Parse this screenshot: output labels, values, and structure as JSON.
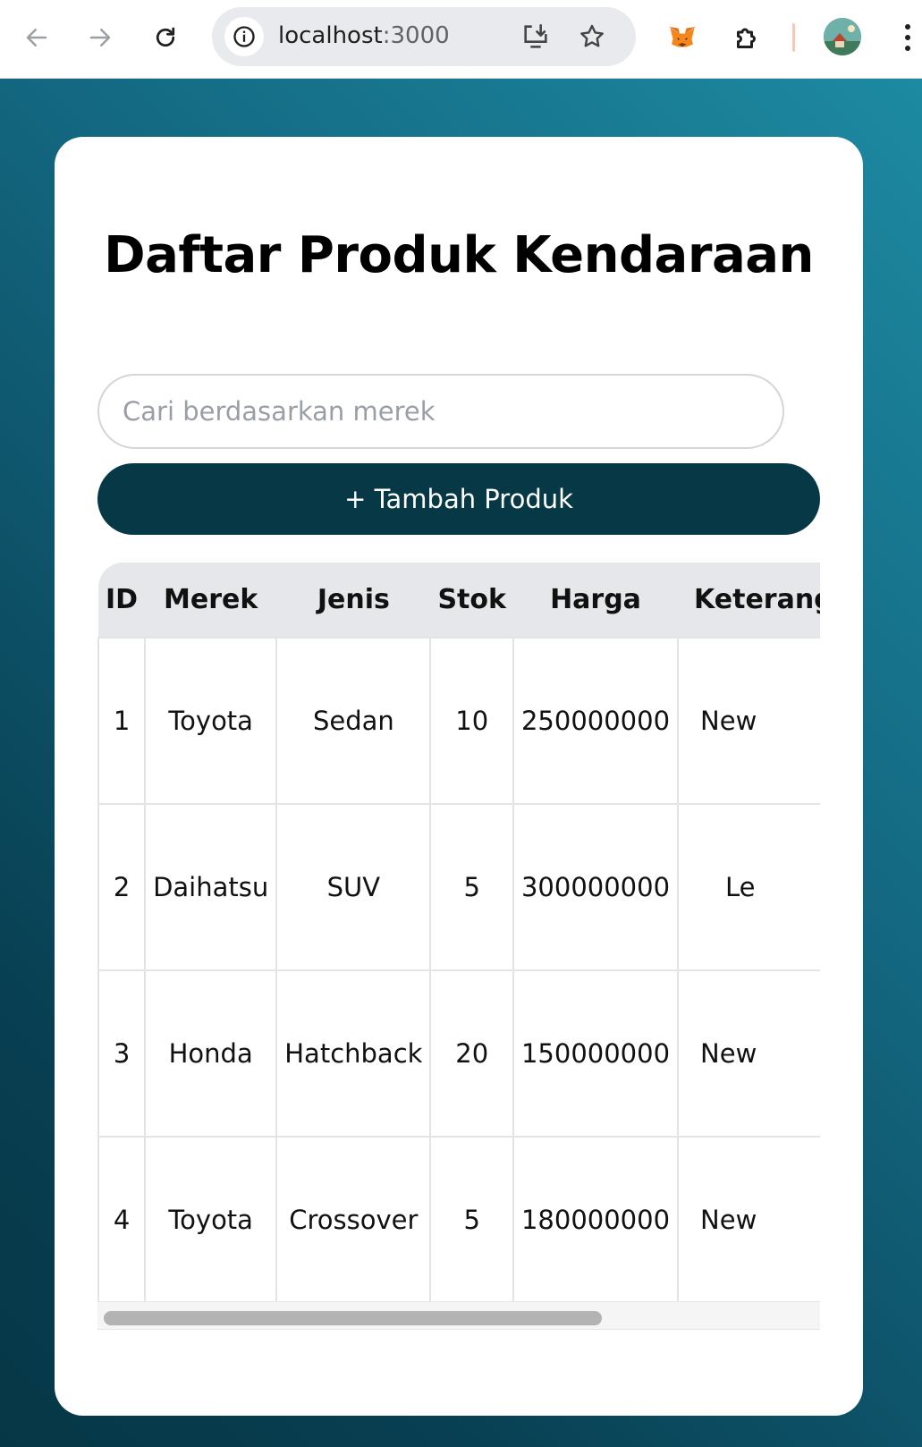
{
  "browser": {
    "url_host": "localhost",
    "url_port": ":3000"
  },
  "page": {
    "title": "Daftar Produk Kendaraan",
    "search_placeholder": "Cari berdasarkan merek",
    "add_button_label": "+ Tambah Produk",
    "table": {
      "headers": [
        "ID",
        "Merek",
        "Jenis",
        "Stok",
        "Harga",
        "Keterangan"
      ],
      "rows": [
        {
          "id": "1",
          "merek": "Toyota",
          "jenis": "Sedan",
          "stok": "10",
          "harga": "250000000",
          "ket": "New"
        },
        {
          "id": "2",
          "merek": "Daihatsu",
          "jenis": "SUV",
          "stok": "5",
          "harga": "300000000",
          "ket": "Le"
        },
        {
          "id": "3",
          "merek": "Honda",
          "jenis": "Hatchback",
          "stok": "20",
          "harga": "150000000",
          "ket": "New"
        },
        {
          "id": "4",
          "merek": "Toyota",
          "jenis": "Crossover",
          "stok": "5",
          "harga": "180000000",
          "ket": "New"
        }
      ]
    }
  }
}
